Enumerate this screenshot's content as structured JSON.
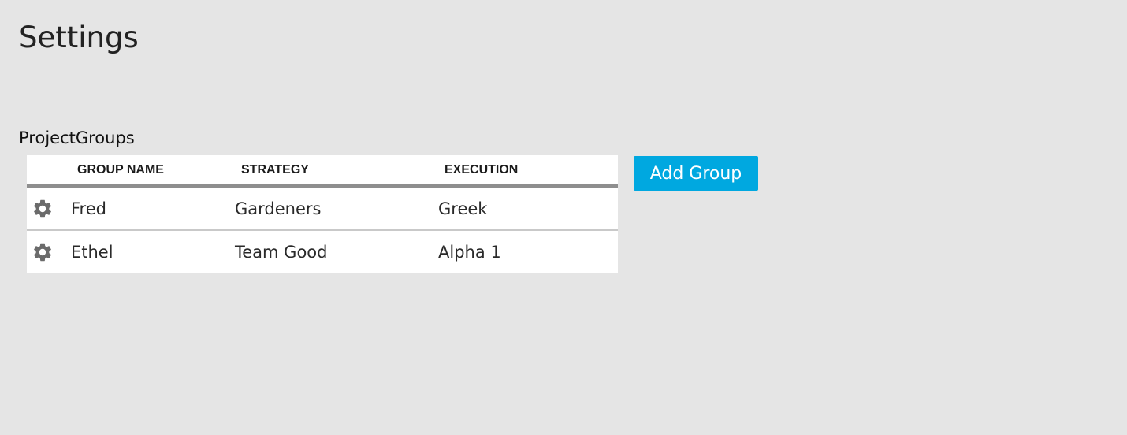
{
  "page": {
    "title": "Settings"
  },
  "project_groups": {
    "section_title": "ProjectGroups",
    "columns": {
      "group_name": "GROUP NAME",
      "strategy": "STRATEGY",
      "execution": "EXECUTION"
    },
    "rows": [
      {
        "icon": "gear-icon",
        "group_name": "Fred",
        "strategy": "Gardeners",
        "execution": "Greek"
      },
      {
        "icon": "gear-icon",
        "group_name": "Ethel",
        "strategy": "Team Good",
        "execution": "Alpha 1"
      }
    ],
    "add_button_label": "Add Group"
  },
  "colors": {
    "background": "#e5e5e5",
    "accent": "#00a8e0",
    "icon": "#6b6b6b"
  }
}
